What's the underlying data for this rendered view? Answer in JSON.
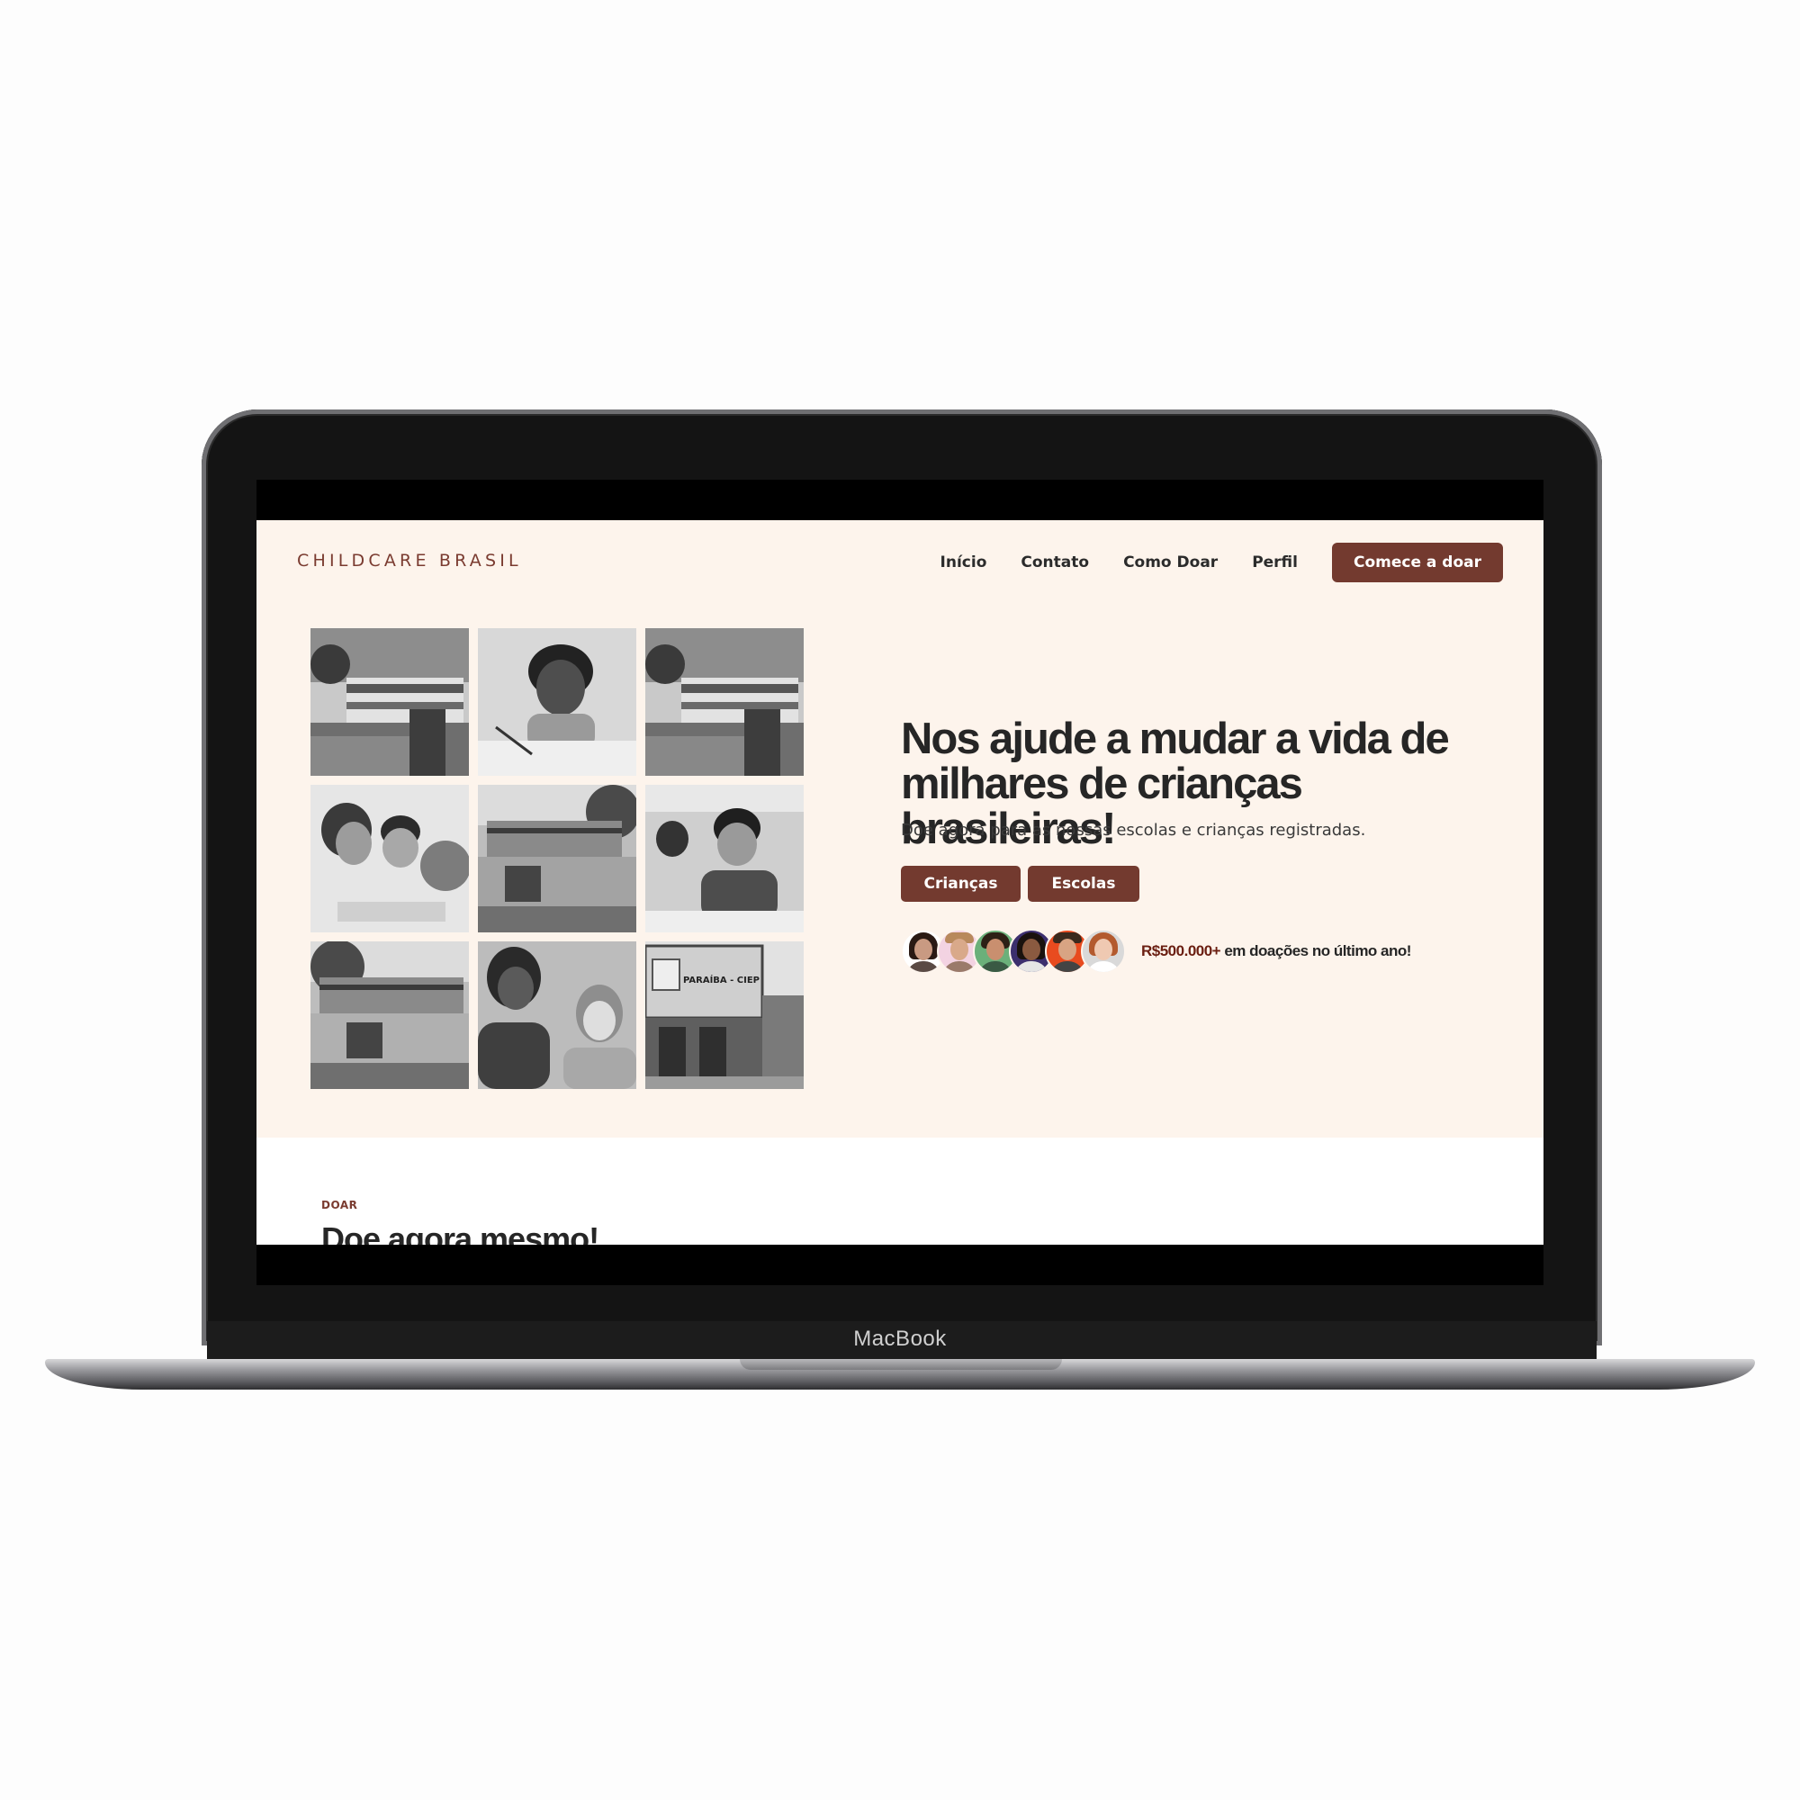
{
  "device": {
    "label": "MacBook"
  },
  "header": {
    "logo": "CHILDCARE BRASIL",
    "nav": [
      "Início",
      "Contato",
      "Como Doar",
      "Perfil"
    ],
    "cta": "Comece a doar"
  },
  "hero": {
    "title": "Nos ajude a mudar a vida de milhares de crianças brasileiras!",
    "subtitle": "Doe agora para as nossas escolas e crianças registradas.",
    "buttons": [
      "Crianças",
      "Escolas"
    ],
    "stat_amount": "R$500.000+",
    "stat_text": " em doações no último ano!",
    "photos": [
      "school-building",
      "girl-writing",
      "school-building",
      "children-with-globe",
      "school-street",
      "boy-in-classroom",
      "school-street",
      "girls-smiling",
      "school-entrance"
    ],
    "school_sign": "PARAÍBA - CIEP"
  },
  "next_section": {
    "tag": "DOAR",
    "title": "Doe agora mesmo!"
  },
  "colors": {
    "accent": "#733a2f",
    "hero_bg": "#fdf4ec",
    "amount": "#6b1f12"
  }
}
